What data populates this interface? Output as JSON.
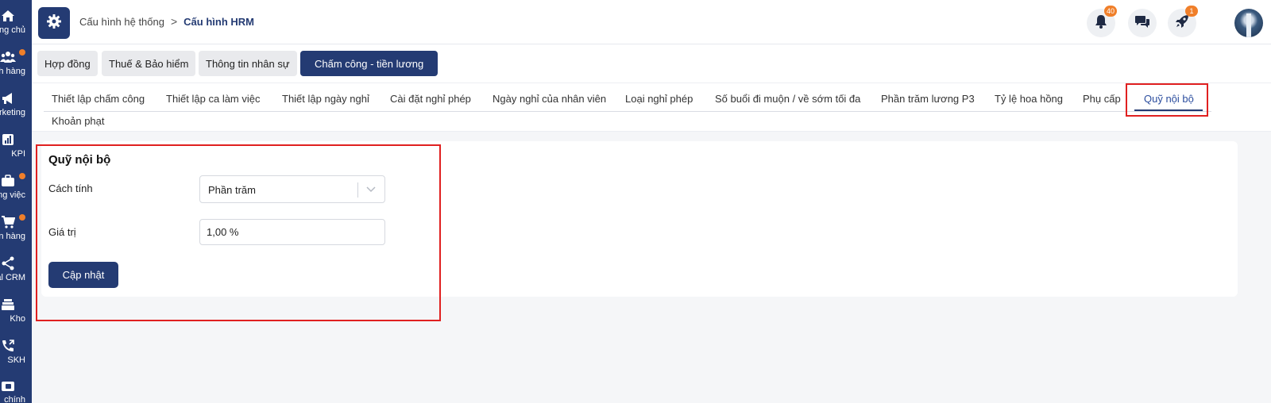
{
  "sidebar": {
    "items": [
      {
        "label": "ng chủ",
        "icon": "home-icon",
        "dot": false
      },
      {
        "label": "ch hàng",
        "icon": "users-icon",
        "dot": true
      },
      {
        "label": "rketing",
        "icon": "megaphone-icon",
        "dot": false
      },
      {
        "label": "KPI",
        "icon": "bar-chart-icon",
        "dot": false
      },
      {
        "label": "ng việc",
        "icon": "briefcase-icon",
        "dot": true
      },
      {
        "label": "n hàng",
        "icon": "cart-icon",
        "dot": true
      },
      {
        "label": "al CRM",
        "icon": "share-icon",
        "dot": false
      },
      {
        "label": "Kho",
        "icon": "warehouse-icon",
        "dot": false
      },
      {
        "label": "SKH",
        "icon": "phone-icon",
        "dot": false
      },
      {
        "label": "chính",
        "icon": "wallet-icon",
        "dot": false
      }
    ]
  },
  "header": {
    "breadcrumb_root": "Cấu hình hệ thống",
    "breadcrumb_sep": ">",
    "breadcrumb_current": "Cấu hình HRM",
    "notifications_count": "40",
    "rocket_count": "1"
  },
  "main_tabs": [
    "Hợp đồng",
    "Thuế & Bảo hiểm",
    "Thông tin nhân sự",
    "Chấm công - tiền lương"
  ],
  "sub_tabs": [
    "Thiết lập chấm công",
    "Thiết lập ca làm việc",
    "Thiết lập ngày nghỉ",
    "Cài đặt nghỉ phép",
    "Ngày nghỉ của nhân viên",
    "Loại nghỉ phép",
    "Số buổi đi muộn / về sớm tối đa",
    "Phần trăm lương P3",
    "Tỷ lệ hoa hồng",
    "Phụ cấp",
    "Quỹ nội bộ",
    "Khoản phạt"
  ],
  "form": {
    "title": "Quỹ nội bộ",
    "method_label": "Cách tính",
    "method_value": "Phần trăm",
    "value_label": "Giá trị",
    "value_value": "1,00 %",
    "submit_label": "Cập nhật"
  },
  "colors": {
    "primary": "#243b73",
    "badge": "#f07f2a",
    "highlight": "#e02020"
  }
}
